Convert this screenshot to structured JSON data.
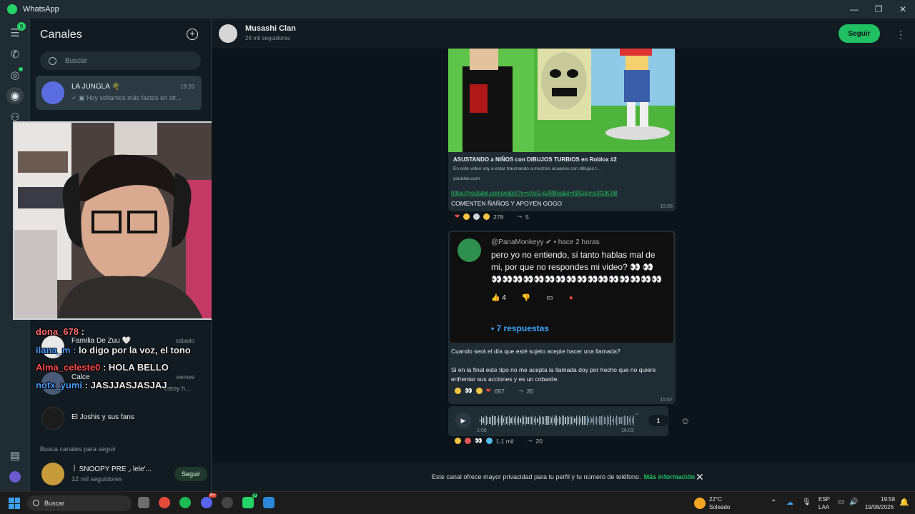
{
  "window": {
    "title": "WhatsApp",
    "controls": [
      "—",
      "❐",
      "✕"
    ]
  },
  "rail": {
    "chats_badge": "9"
  },
  "sidebar": {
    "title": "Canales",
    "search_placeholder": "Buscar",
    "channels": [
      {
        "name": "LA JUNGLA 🌴",
        "time": "19:26",
        "preview": "Hoy soltamos más factos en str..."
      },
      {
        "name": "Familia De Zuu 🤍",
        "time": "sábado",
        "preview": ""
      },
      {
        "name": "Calce",
        "time": "viernes",
        "preview": "estoy h..."
      },
      {
        "name": "El Joshis y sus fans",
        "time": "",
        "preview": ""
      }
    ],
    "discover_title": "Busca canales para seguir",
    "suggested": {
      "name": "꒱ SNOOPY PRE ◞ lele'...",
      "followers": "12 mil seguidores",
      "follow_label": "Seguir"
    }
  },
  "stream_overlay": {
    "lines": [
      {
        "user": "dona_678",
        "sep": " :",
        "msg": "",
        "color": "#ff6b6b"
      },
      {
        "user": "",
        "sep": "",
        "msg": "lo digo por la voz, el tono",
        "color": "#e9edef",
        "prefix": "ilana_m :"
      },
      {
        "user": "Alma_celeste0",
        "sep": " :",
        "msg": " HOLA BELLO",
        "color": "#ff4d4d"
      },
      {
        "user": "notx_yumi",
        "sep": " :",
        "msg": " JASJJASJASJAJ",
        "color": "#4d9cff"
      }
    ]
  },
  "chat": {
    "name": "Musashi Clan",
    "followers": "26 mil seguidores",
    "follow_label": "Seguir",
    "messages": {
      "yt": {
        "title": "ASUSTANDO a NIÑOS con DIBUJOS TURBIOS en Roblox #2",
        "desc": "En este video voy a estar traumando a muchos usuarios con dibujos t...",
        "domain": "youtube.com",
        "link": "https://youtube.com/watch?v=vXcG-gJRBIo&si=Il9Gjzync3f1tKXB",
        "caption": "COMENTEN ÑAÑOS Y APOYEN GOGO",
        "time": "15:06",
        "reaction_count": "278",
        "forwards": "5"
      },
      "comment": {
        "user": "@PanaMonkeyy",
        "when": "hace 2 horas",
        "text": "pero yo no entiendo, si tanto hablas mal de mi, por que no respondes mi video? 👀 👀👀👀👀👀👀👀👀👀👀👀👀👀👀👀👀👀",
        "likes": "4",
        "replies": "• 7 respuestas",
        "msg1": "Cuando será el día que esté sujeto acepte hacer una llamada?",
        "msg2": "Si en la final este tipo no me acepta la llamada doy por hecho que no quiere enfrentar sus acciones y es un cobarde.",
        "time": "15:57",
        "reaction_count": "657",
        "forwards": "20"
      },
      "audio": {
        "elapsed": "1:08",
        "time": "16:03",
        "speed": "1",
        "progress_fraction": 0.7,
        "reaction_count": "1,1 mil",
        "forwards": "20"
      }
    },
    "privacy_notice": "Este canal ofrece mayor privacidad para tu perfil y tu número de teléfono.",
    "privacy_link": "Más información"
  },
  "taskbar": {
    "search": "Buscar",
    "weather_temp": "22°C",
    "weather_desc": "Soleado",
    "lang1": "ESP",
    "lang2": "LAA",
    "clock_time": "19:58",
    "clock_date": "19/08/2026",
    "discord_badge": "9+",
    "whatsapp_badge": "9"
  },
  "colors": {
    "accent": "#21c063",
    "bg": "#0b141a",
    "panel": "#111b21",
    "bubble": "#202c33"
  }
}
